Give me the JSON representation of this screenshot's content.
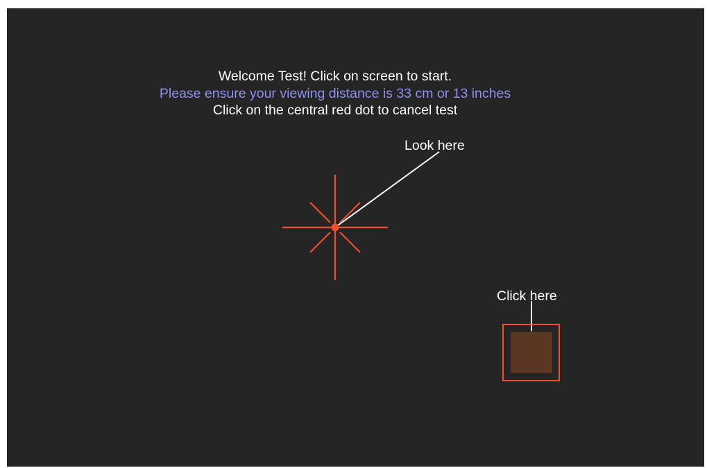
{
  "instructions": {
    "welcome": "Welcome Test! Click on screen to start.",
    "distance_notice": "Please ensure your viewing distance is 33 cm or 13 inches",
    "cancel_hint": "Click on the central red dot to cancel test"
  },
  "labels": {
    "look": "Look here",
    "click": "Click here"
  },
  "colors": {
    "background": "#252525",
    "text": "#ffffff",
    "notice": "#8f8ff2",
    "stimulus": "#f0502c",
    "target_fill": "#5a3623"
  },
  "icons": {
    "fixation": "starburst-fixation-icon",
    "target": "square-target-icon"
  }
}
